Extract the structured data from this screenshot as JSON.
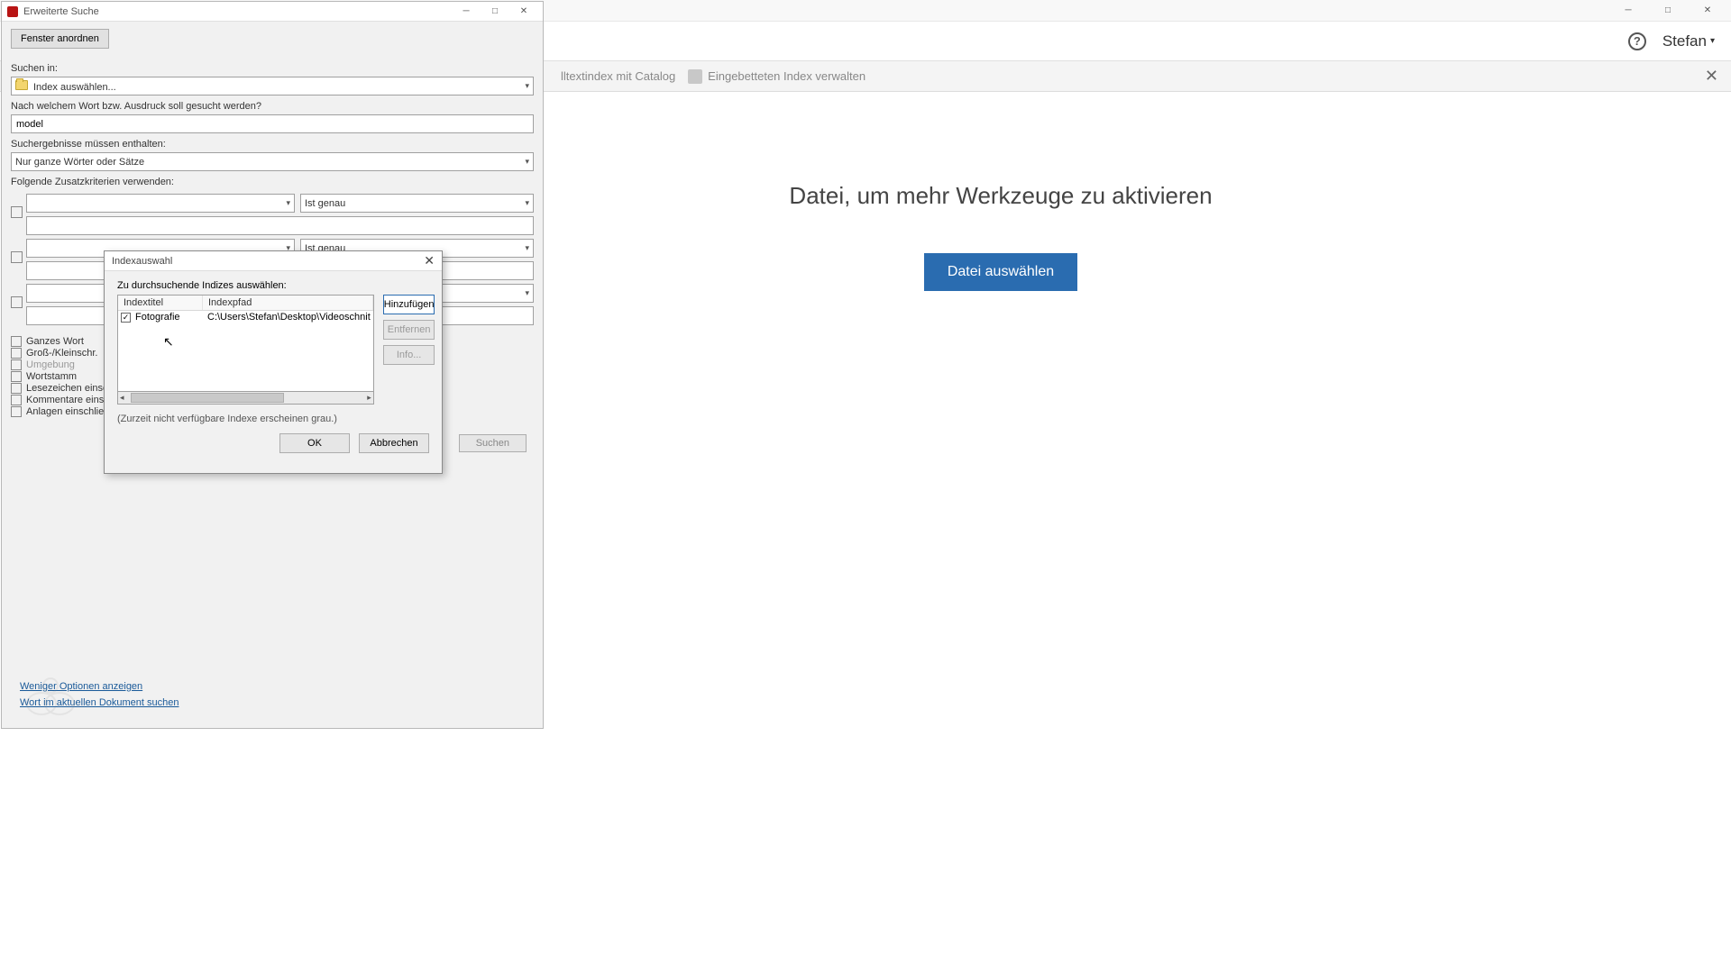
{
  "main": {
    "user": "Stefan",
    "sub_item1": "lltextindex mit Catalog",
    "sub_item2": "Eingebetteten Index verwalten",
    "content_text": "Datei, um mehr Werkzeuge zu aktivieren",
    "select_file_btn": "Datei auswählen"
  },
  "search": {
    "title": "Erweiterte Suche",
    "arrange_btn": "Fenster anordnen",
    "search_in_label": "Suchen in:",
    "search_in_value": "Index auswählen...",
    "word_label": "Nach welchem Wort bzw. Ausdruck soll gesucht werden?",
    "word_value": "model",
    "results_label": "Suchergebnisse müssen enthalten:",
    "results_value": "Nur ganze Wörter oder Sätze",
    "criteria_label": "Folgende Zusatzkriterien verwenden:",
    "criteria_match": "Ist genau",
    "options": {
      "whole_word": "Ganzes Wort",
      "case": "Groß-/Kleinschr.",
      "proximity": "Umgebung",
      "stem": "Wortstamm",
      "bookmarks": "Lesezeichen einschließen",
      "comments": "Kommentare einschließen",
      "attachments": "Anlagen einschließen"
    },
    "search_btn": "Suchen",
    "footer_link1": "Weniger Optionen anzeigen",
    "footer_link2": "Wort im aktuellen Dokument suchen"
  },
  "dialog": {
    "title": "Indexauswahl",
    "instruction": "Zu durchsuchende Indizes auswählen:",
    "col_title": "Indextitel",
    "col_path": "Indexpfad",
    "row_title": "Fotografie",
    "row_path": "C:\\Users\\Stefan\\Desktop\\Videoschnit",
    "btn_add": "Hinzufügen",
    "btn_remove": "Entfernen",
    "btn_info": "Info...",
    "hint": "(Zurzeit nicht verfügbare Indexe erscheinen grau.)",
    "btn_ok": "OK",
    "btn_cancel": "Abbrechen"
  }
}
